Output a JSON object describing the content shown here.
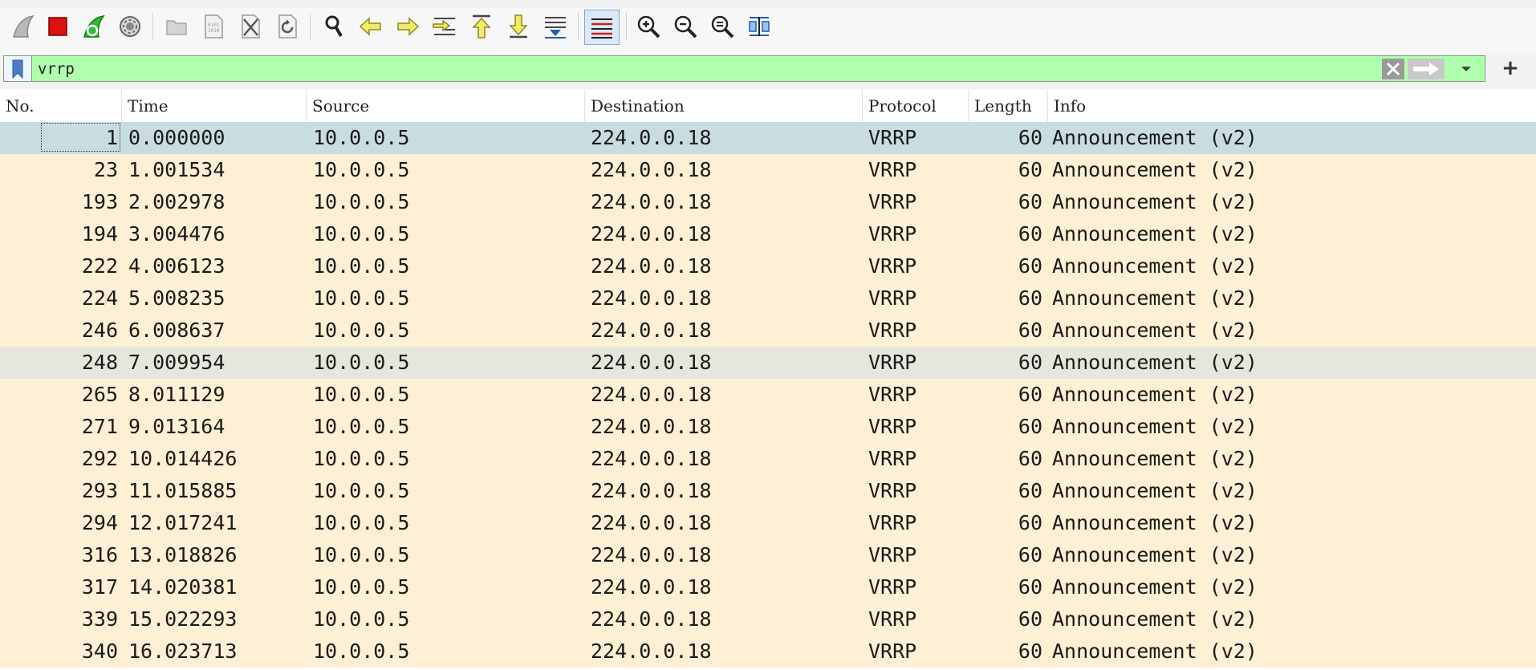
{
  "toolbar": {
    "buttons": [
      {
        "name": "start-capture-icon"
      },
      {
        "name": "stop-capture-icon"
      },
      {
        "name": "restart-capture-icon"
      },
      {
        "name": "capture-options-icon"
      },
      {
        "name": "open-file-icon"
      },
      {
        "name": "save-file-icon"
      },
      {
        "name": "close-file-icon"
      },
      {
        "name": "reload-file-icon"
      },
      {
        "name": "find-packet-icon"
      },
      {
        "name": "go-back-icon"
      },
      {
        "name": "go-forward-icon"
      },
      {
        "name": "go-to-packet-icon"
      },
      {
        "name": "go-first-packet-icon"
      },
      {
        "name": "go-last-packet-icon"
      },
      {
        "name": "auto-scroll-icon"
      },
      {
        "name": "colorize-icon"
      },
      {
        "name": "zoom-in-icon"
      },
      {
        "name": "zoom-out-icon"
      },
      {
        "name": "zoom-normal-icon"
      },
      {
        "name": "resize-columns-icon"
      }
    ]
  },
  "filter": {
    "value": "vrrp",
    "bg_color": "#afffaf"
  },
  "columns": [
    "No.",
    "Time",
    "Source",
    "Destination",
    "Protocol",
    "Length",
    "Info"
  ],
  "packets": [
    {
      "no": "1",
      "time": "0.000000",
      "source": "10.0.0.5",
      "destination": "224.0.0.18",
      "protocol": "VRRP",
      "length": "60",
      "info": "Announcement (v2)",
      "state": "selected"
    },
    {
      "no": "23",
      "time": "1.001534",
      "source": "10.0.0.5",
      "destination": "224.0.0.18",
      "protocol": "VRRP",
      "length": "60",
      "info": "Announcement (v2)"
    },
    {
      "no": "193",
      "time": "2.002978",
      "source": "10.0.0.5",
      "destination": "224.0.0.18",
      "protocol": "VRRP",
      "length": "60",
      "info": "Announcement (v2)"
    },
    {
      "no": "194",
      "time": "3.004476",
      "source": "10.0.0.5",
      "destination": "224.0.0.18",
      "protocol": "VRRP",
      "length": "60",
      "info": "Announcement (v2)"
    },
    {
      "no": "222",
      "time": "4.006123",
      "source": "10.0.0.5",
      "destination": "224.0.0.18",
      "protocol": "VRRP",
      "length": "60",
      "info": "Announcement (v2)"
    },
    {
      "no": "224",
      "time": "5.008235",
      "source": "10.0.0.5",
      "destination": "224.0.0.18",
      "protocol": "VRRP",
      "length": "60",
      "info": "Announcement (v2)"
    },
    {
      "no": "246",
      "time": "6.008637",
      "source": "10.0.0.5",
      "destination": "224.0.0.18",
      "protocol": "VRRP",
      "length": "60",
      "info": "Announcement (v2)"
    },
    {
      "no": "248",
      "time": "7.009954",
      "source": "10.0.0.5",
      "destination": "224.0.0.18",
      "protocol": "VRRP",
      "length": "60",
      "info": "Announcement (v2)",
      "state": "hover"
    },
    {
      "no": "265",
      "time": "8.011129",
      "source": "10.0.0.5",
      "destination": "224.0.0.18",
      "protocol": "VRRP",
      "length": "60",
      "info": "Announcement (v2)"
    },
    {
      "no": "271",
      "time": "9.013164",
      "source": "10.0.0.5",
      "destination": "224.0.0.18",
      "protocol": "VRRP",
      "length": "60",
      "info": "Announcement (v2)"
    },
    {
      "no": "292",
      "time": "10.014426",
      "source": "10.0.0.5",
      "destination": "224.0.0.18",
      "protocol": "VRRP",
      "length": "60",
      "info": "Announcement (v2)"
    },
    {
      "no": "293",
      "time": "11.015885",
      "source": "10.0.0.5",
      "destination": "224.0.0.18",
      "protocol": "VRRP",
      "length": "60",
      "info": "Announcement (v2)"
    },
    {
      "no": "294",
      "time": "12.017241",
      "source": "10.0.0.5",
      "destination": "224.0.0.18",
      "protocol": "VRRP",
      "length": "60",
      "info": "Announcement (v2)"
    },
    {
      "no": "316",
      "time": "13.018826",
      "source": "10.0.0.5",
      "destination": "224.0.0.18",
      "protocol": "VRRP",
      "length": "60",
      "info": "Announcement (v2)"
    },
    {
      "no": "317",
      "time": "14.020381",
      "source": "10.0.0.5",
      "destination": "224.0.0.18",
      "protocol": "VRRP",
      "length": "60",
      "info": "Announcement (v2)"
    },
    {
      "no": "339",
      "time": "15.022293",
      "source": "10.0.0.5",
      "destination": "224.0.0.18",
      "protocol": "VRRP",
      "length": "60",
      "info": "Announcement (v2)"
    },
    {
      "no": "340",
      "time": "16.023713",
      "source": "10.0.0.5",
      "destination": "224.0.0.18",
      "protocol": "VRRP",
      "length": "60",
      "info": "Announcement (v2)"
    }
  ],
  "colors": {
    "row_bg": "#fdf0d5",
    "selected_bg": "#c9dde1",
    "hover_bg": "#e6e6dc",
    "stop_red": "#dd1111",
    "fin_green": "#22aa22"
  }
}
